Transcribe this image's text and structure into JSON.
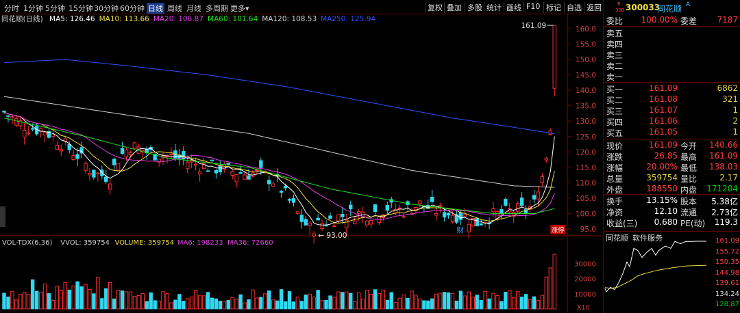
{
  "toolbar": {
    "timeframes": [
      "分时",
      "1分钟",
      "5分钟",
      "15分钟",
      "30分钟",
      "60分钟",
      "日线",
      "周线",
      "月线",
      "多周期",
      "更多"
    ],
    "active_timeframe": "日线",
    "buttons": [
      "复权",
      "叠加",
      "多股",
      "统计",
      "画线",
      "F10",
      "标记",
      "自选",
      "返回"
    ]
  },
  "chart_title": "同花顺(日线)",
  "ma_legend": [
    {
      "label": "MA5: 126.46",
      "color": "#ffffff"
    },
    {
      "label": "MA10: 113.66",
      "color": "#f0e040"
    },
    {
      "label": "MA20: 106.87",
      "color": "#e040e0"
    },
    {
      "label": "MA60: 101.64",
      "color": "#20e020"
    },
    {
      "label": "MA120: 108.53",
      "color": "#d0d0d0"
    },
    {
      "label": "MA250: 125.94",
      "color": "#3050ff"
    }
  ],
  "price_axis": [
    "160.0",
    "155.0",
    "150.0",
    "145.0",
    "140.0",
    "135.0",
    "130.0",
    "125.0",
    "120.0",
    "115.0",
    "110.0",
    "105.0",
    "100.0",
    "95.0"
  ],
  "annotations": {
    "high": "161.09",
    "low": "93.00",
    "event_marker": "财",
    "limit_badge": "涨停"
  },
  "volume_legend": [
    {
      "label": "VOL-TDX(6,36)",
      "color": "#d0d0d0"
    },
    {
      "label": "VVOL: 359754",
      "color": "#d0d0d0"
    },
    {
      "label": "VOLUME: 359754",
      "color": "#f0e040"
    },
    {
      "label": "MA6: 198233",
      "color": "#e040e0"
    },
    {
      "label": "MA36: 72660",
      "color": "#e040e0"
    }
  ],
  "volume_axis": [
    "30000",
    "20000",
    "10000"
  ],
  "volume_unit": "X10",
  "quote": {
    "market_tag": "R",
    "board_tag": "300",
    "code": "300033",
    "name": "同花顺",
    "name_suffix": "A",
    "wei_bi_label": "委比",
    "wei_bi": "100.00%",
    "wei_cha_label": "委差",
    "wei_cha": "7187",
    "asks": [
      {
        "label": "卖五",
        "price": "",
        "vol": ""
      },
      {
        "label": "卖四",
        "price": "",
        "vol": ""
      },
      {
        "label": "卖三",
        "price": "",
        "vol": ""
      },
      {
        "label": "卖二",
        "price": "",
        "vol": ""
      },
      {
        "label": "卖一",
        "price": "",
        "vol": ""
      }
    ],
    "bids": [
      {
        "label": "买一",
        "price": "161.09",
        "vol": "6862"
      },
      {
        "label": "买二",
        "price": "161.08",
        "vol": "321"
      },
      {
        "label": "买三",
        "price": "161.07",
        "vol": "1"
      },
      {
        "label": "买四",
        "price": "161.06",
        "vol": "2"
      },
      {
        "label": "买五",
        "price": "161.05",
        "vol": "1"
      }
    ],
    "stats": [
      {
        "l1": "现价",
        "v1": "161.09",
        "c1": "red",
        "l2": "今开",
        "v2": "140.66",
        "c2": "red"
      },
      {
        "l1": "涨跌",
        "v1": "26.85",
        "c1": "red",
        "l2": "最高",
        "v2": "161.09",
        "c2": "red"
      },
      {
        "l1": "涨幅",
        "v1": "20.00%",
        "c1": "red",
        "l2": "最低",
        "v2": "138.03",
        "c2": "red"
      },
      {
        "l1": "总量",
        "v1": "359754",
        "c1": "yel",
        "l2": "量比",
        "v2": "2.17",
        "c2": "yel"
      },
      {
        "l1": "外盘",
        "v1": "188550",
        "c1": "red",
        "l2": "内盘",
        "v2": "171204",
        "c2": "grn"
      }
    ],
    "stats2": [
      {
        "l1": "换手",
        "v1": "13.15%",
        "c1": "wht",
        "l2": "股本",
        "v2": "5.38亿",
        "c2": "wht"
      },
      {
        "l1": "净资",
        "v1": "12.10",
        "c1": "wht",
        "l2": "流通",
        "v2": "2.73亿",
        "c2": "wht"
      },
      {
        "l1": "收益(三)",
        "v1": "0.680",
        "c1": "wht",
        "l2": "PE(动)",
        "v2": "119.3",
        "c2": "wht"
      }
    ]
  },
  "mini_chart": {
    "title": "同花顺",
    "tab": "软件服务",
    "axis": [
      {
        "v": "161.09",
        "c": "#ff3d3d"
      },
      {
        "v": "155.72",
        "c": "#ff3d3d"
      },
      {
        "v": "150.35",
        "c": "#ff3d3d"
      },
      {
        "v": "144.98",
        "c": "#ff3d3d"
      },
      {
        "v": "139.61",
        "c": "#ff3d3d"
      },
      {
        "v": "134.24",
        "c": "#dddddd"
      },
      {
        "v": "128.87",
        "c": "#00d000"
      }
    ]
  }
}
